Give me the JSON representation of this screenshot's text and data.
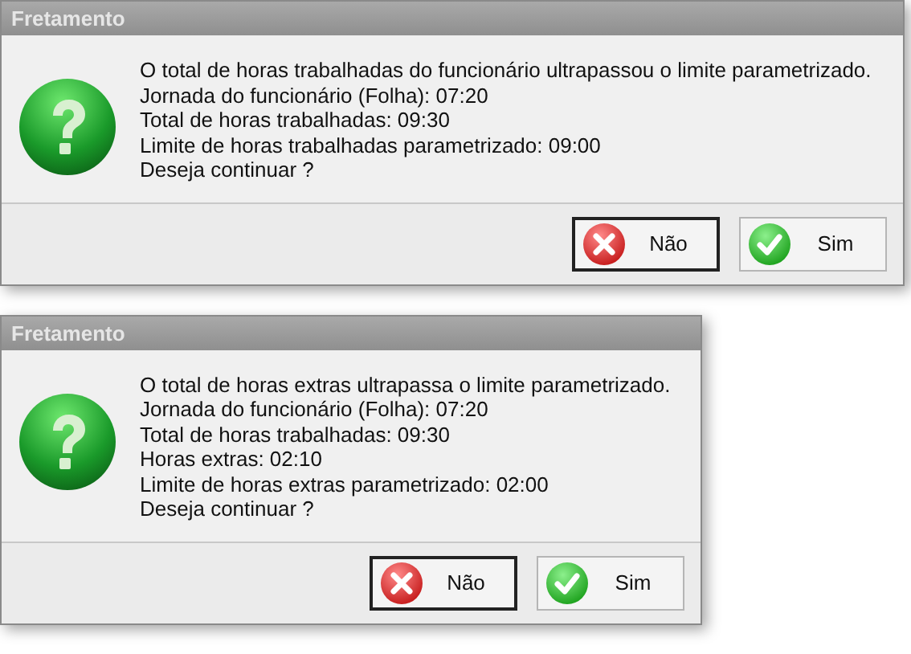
{
  "dialogs": [
    {
      "title": "Fretamento",
      "lines": [
        "O total de horas trabalhadas do funcionário ultrapassou o limite parametrizado.",
        "Jornada do funcionário (Folha): 07:20",
        "Total de horas trabalhadas: 09:30",
        "Limite de horas trabalhadas parametrizado: 09:00",
        "Deseja continuar ?"
      ],
      "buttons": [
        {
          "label": "Não",
          "kind": "no",
          "focused": true
        },
        {
          "label": "Sim",
          "kind": "yes",
          "focused": false
        }
      ]
    },
    {
      "title": "Fretamento",
      "lines": [
        "O total de horas extras ultrapassa o limite parametrizado.",
        "Jornada do funcionário (Folha): 07:20",
        "Total de horas trabalhadas: 09:30",
        "Horas extras: 02:10",
        "Limite de horas extras parametrizado: 02:00",
        "Deseja continuar ?"
      ],
      "buttons": [
        {
          "label": "Não",
          "kind": "no",
          "focused": true
        },
        {
          "label": "Sim",
          "kind": "yes",
          "focused": false
        }
      ]
    }
  ]
}
